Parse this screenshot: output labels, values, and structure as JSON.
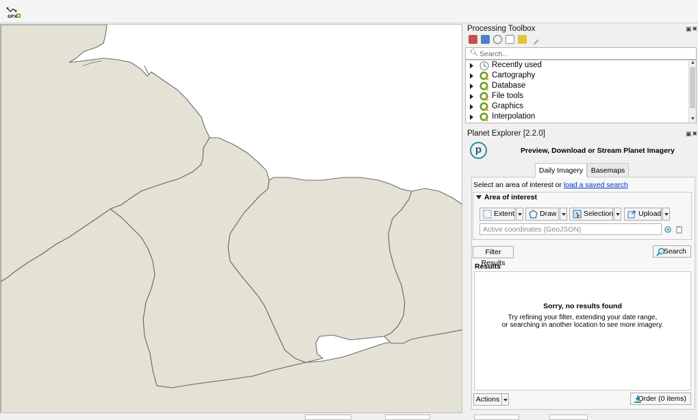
{
  "toolbar": {
    "gpx_label": "GPX"
  },
  "processing_toolbox": {
    "title": "Processing Toolbox",
    "search_placeholder": "Search...",
    "items": [
      {
        "label": "Recently used",
        "icon": "clock-icon"
      },
      {
        "label": "Cartography",
        "icon": "qgis-icon"
      },
      {
        "label": "Database",
        "icon": "qgis-icon"
      },
      {
        "label": "File tools",
        "icon": "qgis-icon"
      },
      {
        "label": "Graphics",
        "icon": "qgis-icon"
      },
      {
        "label": "Interpolation",
        "icon": "qgis-icon"
      }
    ]
  },
  "planet_explorer": {
    "title": "Planet Explorer [2.2.0]",
    "logo_letter": "p",
    "heading": "Preview, Download or Stream Planet Imagery",
    "tabs": [
      "Daily Imagery",
      "Basemaps"
    ],
    "active_tab": "Daily Imagery",
    "select_text": "Select an area of interest or ",
    "saved_search_link": "load a saved search",
    "aoi_title": "Area of interest",
    "aoi_buttons": [
      "Extent",
      "Draw",
      "Selection",
      "Upload"
    ],
    "coords_placeholder": "Active coordinates (GeoJSON)",
    "filter_button": "Filter Results",
    "search_button": "Search",
    "results_label": "Results",
    "empty_title": "Sorry, no results found",
    "empty_line1": "Try refining your filter, extending your date range,",
    "empty_line2": "or searching in another location to see more imagery.",
    "actions_button": "Actions",
    "order_button": "Order (0 items)"
  },
  "colors": {
    "land": "#e3e2d4",
    "border": "#6b6b6b",
    "accent": "#2a8ea5",
    "qgis_green": "#6b9e2f"
  }
}
